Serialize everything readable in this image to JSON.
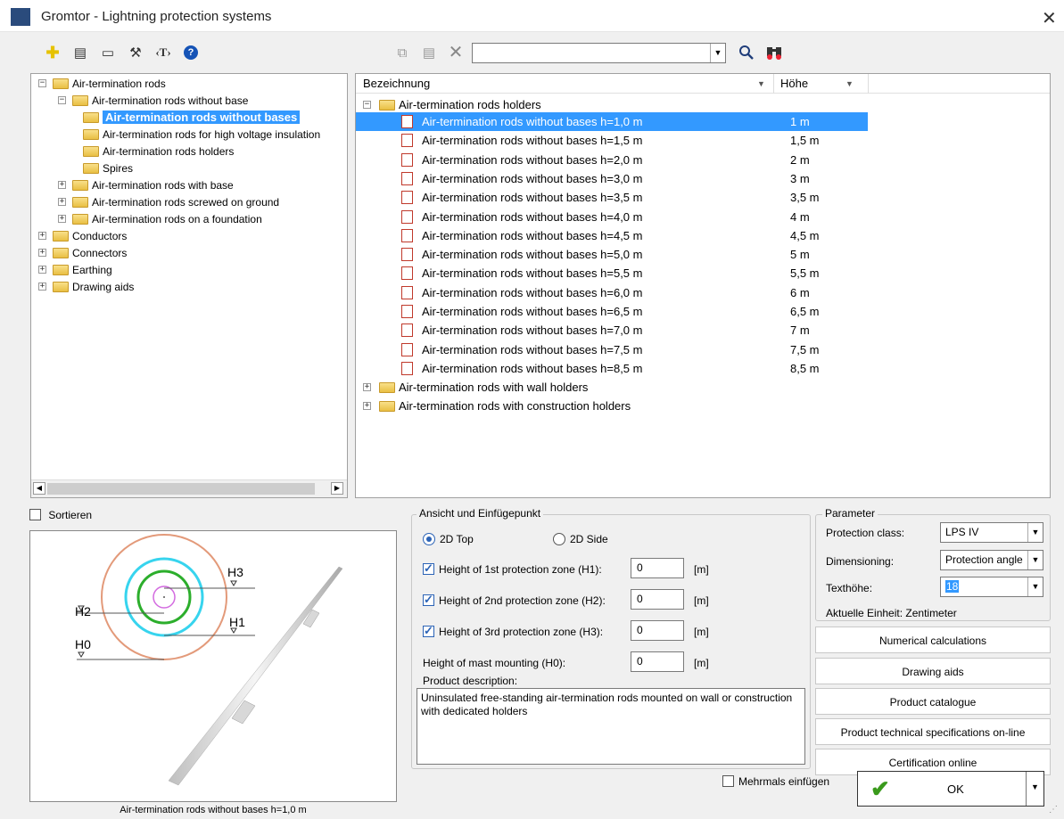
{
  "window": {
    "title": "Gromtor - Lightning protection systems"
  },
  "toolbar": {
    "search_value": ""
  },
  "tree": {
    "items": [
      {
        "label": "Air-termination rods",
        "level": 0,
        "expanded": true
      },
      {
        "label": "Air-termination rods without base",
        "level": 1,
        "expanded": true
      },
      {
        "label": "Air-termination rods without bases",
        "level": 2,
        "selected": true
      },
      {
        "label": "Air-termination rods for high voltage insulation",
        "level": 2
      },
      {
        "label": "Air-termination rods holders",
        "level": 2
      },
      {
        "label": "Spires",
        "level": 2
      },
      {
        "label": "Air-termination rods with base",
        "level": 1
      },
      {
        "label": "Air-termination rods screwed on ground",
        "level": 1
      },
      {
        "label": "Air-termination rods on a foundation",
        "level": 1
      },
      {
        "label": "Conductors",
        "level": 0
      },
      {
        "label": "Connectors",
        "level": 0
      },
      {
        "label": "Earthing",
        "level": 0
      },
      {
        "label": "Drawing aids",
        "level": 0
      }
    ]
  },
  "list": {
    "columns": {
      "name": "Bezeichnung",
      "height": "Höhe"
    },
    "group_label": "Air-termination rods holders",
    "rows": [
      {
        "name": "Air-termination rods without bases h=1,0 m",
        "height": "1 m"
      },
      {
        "name": "Air-termination rods without bases h=1,5 m",
        "height": "1,5 m"
      },
      {
        "name": "Air-termination rods without bases h=2,0 m",
        "height": "2 m"
      },
      {
        "name": "Air-termination rods without bases h=3,0 m",
        "height": "3 m"
      },
      {
        "name": "Air-termination rods without bases h=3,5 m",
        "height": "3,5 m"
      },
      {
        "name": "Air-termination rods without bases h=4,0 m",
        "height": "4 m"
      },
      {
        "name": "Air-termination rods without bases h=4,5 m",
        "height": "4,5 m"
      },
      {
        "name": "Air-termination rods without bases h=5,0 m",
        "height": "5 m"
      },
      {
        "name": "Air-termination rods without bases h=5,5 m",
        "height": "5,5 m"
      },
      {
        "name": "Air-termination rods without bases h=6,0 m",
        "height": "6 m"
      },
      {
        "name": "Air-termination rods without bases h=6,5 m",
        "height": "6,5 m"
      },
      {
        "name": "Air-termination rods without bases h=7,0 m",
        "height": "7 m"
      },
      {
        "name": "Air-termination rods without bases h=7,5 m",
        "height": "7,5 m"
      },
      {
        "name": "Air-termination rods without bases h=8,5 m",
        "height": "8,5 m"
      }
    ],
    "trailing_groups": [
      "Air-termination rods with wall holders",
      "Air-termination rods with construction holders"
    ]
  },
  "sort_label": "Sortieren",
  "preview": {
    "labels": {
      "h0": "H0",
      "h1": "H1",
      "h2": "H2",
      "h3": "H3"
    },
    "caption": "Air-termination rods without bases h=1,0 m"
  },
  "view": {
    "group_title": "Ansicht und Einfügepunkt",
    "radio_2d_top": "2D Top",
    "radio_2d_side": "2D Side",
    "h1_label": "Height of 1st protection zone (H1):",
    "h2_label": "Height of 2nd protection zone (H2):",
    "h3_label": "Height of 3rd protection zone (H3):",
    "h0_label": "Height of mast mounting (H0):",
    "h1_value": "0",
    "h2_value": "0",
    "h3_value": "0",
    "h0_value": "0",
    "unit": "[m]",
    "desc_label": "Product description:",
    "desc_text": "Uninsulated free-standing air-termination rods mounted on wall or construction with dedicated holders"
  },
  "params": {
    "group_title": "Parameter",
    "protection_class_label": "Protection class:",
    "protection_class_value": "LPS IV",
    "dimensioning_label": "Dimensioning:",
    "dimensioning_value": "Protection angle",
    "texthoehe_label": "Texthöhe:",
    "texthoehe_value": "18",
    "unit_text": "Aktuelle Einheit: Zentimeter"
  },
  "buttons": {
    "numerical": "Numerical calculations",
    "drawing_aids": "Drawing aids",
    "catalogue": "Product catalogue",
    "specs": "Product technical specifications on-line",
    "certification": "Certification online",
    "ok": "OK",
    "mehrmals": "Mehrmals einfügen"
  },
  "colors": {
    "selection": "#3399ff",
    "accent": "#2b63b6",
    "circle_outer": "#e39a7a",
    "circle_cyan": "#37d4ee",
    "circle_green": "#2cae2c",
    "circle_pink": "#d36be0"
  }
}
